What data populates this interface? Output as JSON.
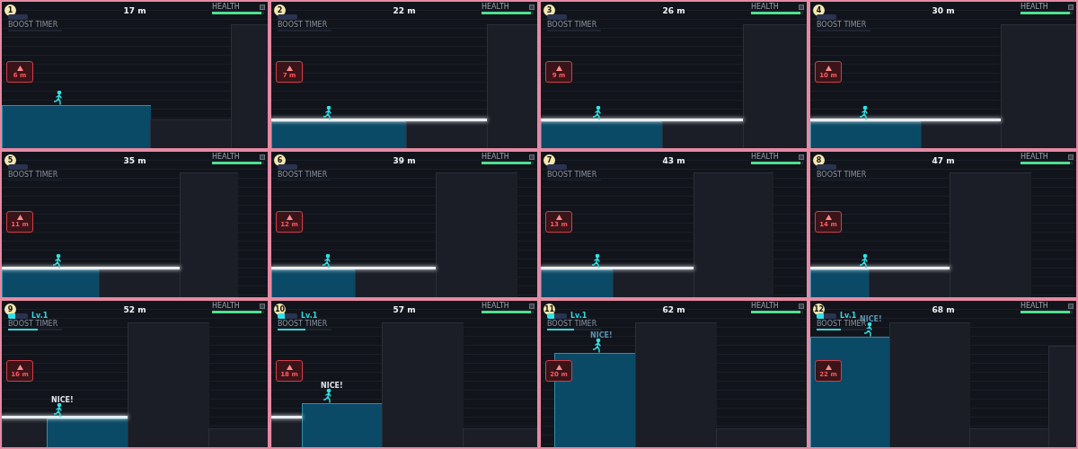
{
  "frames": [
    {
      "number": "1",
      "distance": "17 m",
      "hazard": "6 m",
      "health": {
        "label": "HEALTH",
        "level": 0.95
      },
      "boost": {
        "label": "BOOST TIMER",
        "level": 0
      }
    },
    {
      "number": "2",
      "distance": "22 m",
      "hazard": "7 m",
      "health": {
        "label": "HEALTH",
        "level": 0.95
      },
      "boost": {
        "label": "BOOST TIMER",
        "level": 0
      }
    },
    {
      "number": "3",
      "distance": "26 m",
      "hazard": "9 m",
      "health": {
        "label": "HEALTH",
        "level": 0.95
      },
      "boost": {
        "label": "BOOST TIMER",
        "level": 0
      }
    },
    {
      "number": "4",
      "distance": "30 m",
      "hazard": "10 m",
      "health": {
        "label": "HEALTH",
        "level": 0.95
      },
      "boost": {
        "label": "BOOST TIMER",
        "level": 0
      }
    },
    {
      "number": "5",
      "distance": "35 m",
      "hazard": "11 m",
      "health": {
        "label": "HEALTH",
        "level": 0.95
      },
      "boost": {
        "label": "BOOST TIMER",
        "level": 0
      }
    },
    {
      "number": "6",
      "distance": "39 m",
      "hazard": "12 m",
      "health": {
        "label": "HEALTH",
        "level": 0.95
      },
      "boost": {
        "label": "BOOST TIMER",
        "level": 0
      }
    },
    {
      "number": "7",
      "distance": "43 m",
      "hazard": "13 m",
      "health": {
        "label": "HEALTH",
        "level": 0.95
      },
      "boost": {
        "label": "BOOST TIMER",
        "level": 0
      }
    },
    {
      "number": "8",
      "distance": "47 m",
      "hazard": "14 m",
      "health": {
        "label": "HEALTH",
        "level": 0.95
      },
      "boost": {
        "label": "BOOST TIMER",
        "level": 0
      }
    },
    {
      "number": "9",
      "distance": "52 m",
      "hazard": "16 m",
      "health": {
        "label": "HEALTH",
        "level": 0.95
      },
      "boost": {
        "label": "BOOST TIMER",
        "level": 0.55,
        "rank": "Lv.1"
      },
      "popup": {
        "text": "NICE!",
        "faded": false
      }
    },
    {
      "number": "10",
      "distance": "57 m",
      "hazard": "18 m",
      "health": {
        "label": "HEALTH",
        "level": 0.95
      },
      "boost": {
        "label": "BOOST TIMER",
        "level": 0.52,
        "rank": "Lv.1"
      },
      "popup": {
        "text": "NICE!",
        "faded": false
      }
    },
    {
      "number": "11",
      "distance": "62 m",
      "hazard": "20 m",
      "health": {
        "label": "HEALTH",
        "level": 0.95
      },
      "boost": {
        "label": "BOOST TIMER",
        "level": 0.5,
        "rank": "Lv.1"
      },
      "popup": {
        "text": "NICE!",
        "faded": true
      }
    },
    {
      "number": "12",
      "distance": "68 m",
      "hazard": "22 m",
      "health": {
        "label": "HEALTH",
        "level": 0.95
      },
      "boost": {
        "label": "BOOST TIMER",
        "level": 0.45,
        "rank": "Lv.1"
      },
      "popup": {
        "text": "NICE!",
        "faded": true
      }
    }
  ]
}
